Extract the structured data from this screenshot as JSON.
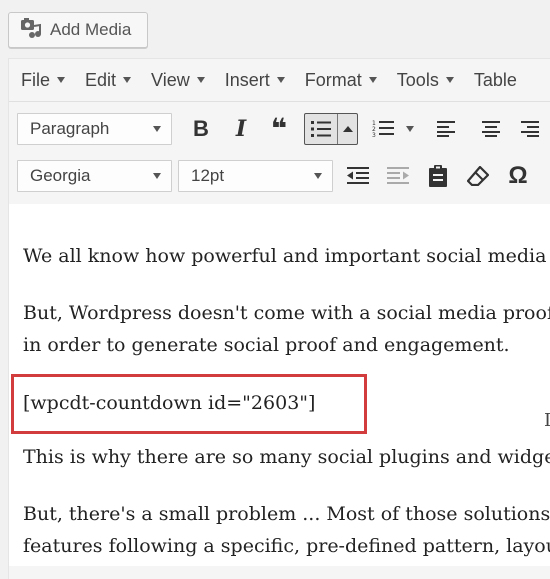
{
  "add_media": {
    "label": "Add Media",
    "icon": "camera-music-icon"
  },
  "menubar": [
    {
      "label": "File"
    },
    {
      "label": "Edit"
    },
    {
      "label": "View"
    },
    {
      "label": "Insert"
    },
    {
      "label": "Format"
    },
    {
      "label": "Tools"
    },
    {
      "label": "Table"
    }
  ],
  "toolbar": {
    "paragraph_select": "Paragraph",
    "font_family_select": "Georgia",
    "font_size_select": "12pt",
    "bold": "B",
    "italic": "I",
    "quote": "❝",
    "special_char": "Ω"
  },
  "content": {
    "p1": "We all know how powerful and important social media",
    "p2_line1": "But, Wordpress doesn't come with a social media proof",
    "p2_line2": "in order to generate social proof and engagement.",
    "shortcode": "[wpcdt-countdown id=\"2603\"]",
    "p3": "This is why there are so many social plugins and widge",
    "p4_line1": "But, there's a small problem ... Most of those solutions",
    "p4_line2": "features following a specific, pre-defined pattern, layou"
  },
  "colors": {
    "highlight": "#d23c3c",
    "toolbar_bg": "#f5f5f5"
  }
}
